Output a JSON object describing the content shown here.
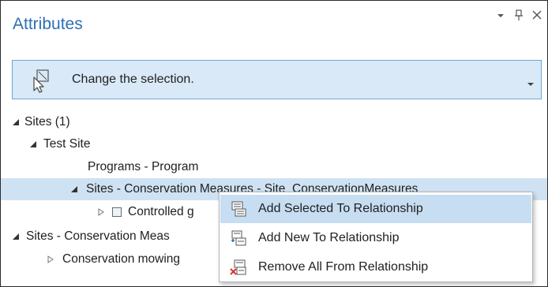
{
  "pane": {
    "title": "Attributes",
    "controls": [
      "chevron-down-icon",
      "pin-icon",
      "close-icon"
    ]
  },
  "selection": {
    "text": "Change the selection.",
    "icon": "selection-pointer-icon"
  },
  "tree": {
    "nodes": [
      {
        "label": "Sites (1)",
        "expanded": true
      },
      {
        "label": "Test Site",
        "expanded": true
      },
      {
        "label": "Programs - Program"
      },
      {
        "label": "Sites - Conservation Measures - Site_ConservationMeasures",
        "expanded": true,
        "selected": true
      },
      {
        "label": "Controlled g",
        "expanded": false,
        "checkbox": true
      },
      {
        "label": "Sites - Conservation Meas",
        "expanded": true
      },
      {
        "label": "Conservation mowing",
        "expanded": false
      }
    ]
  },
  "context_menu": {
    "items": [
      {
        "label": "Add Selected To Relationship",
        "icon": "add-selected-icon",
        "active": true
      },
      {
        "label": "Add New To Relationship",
        "icon": "add-new-icon"
      },
      {
        "label": "Remove All From Relationship",
        "icon": "remove-all-icon"
      }
    ]
  },
  "colors": {
    "title": "#2e6fb5",
    "selection_bar": "#d9e9f7",
    "selection_border": "#6fa6d6",
    "row_highlight": "#cfe2f3",
    "menu_highlight": "#c7ddf1"
  }
}
